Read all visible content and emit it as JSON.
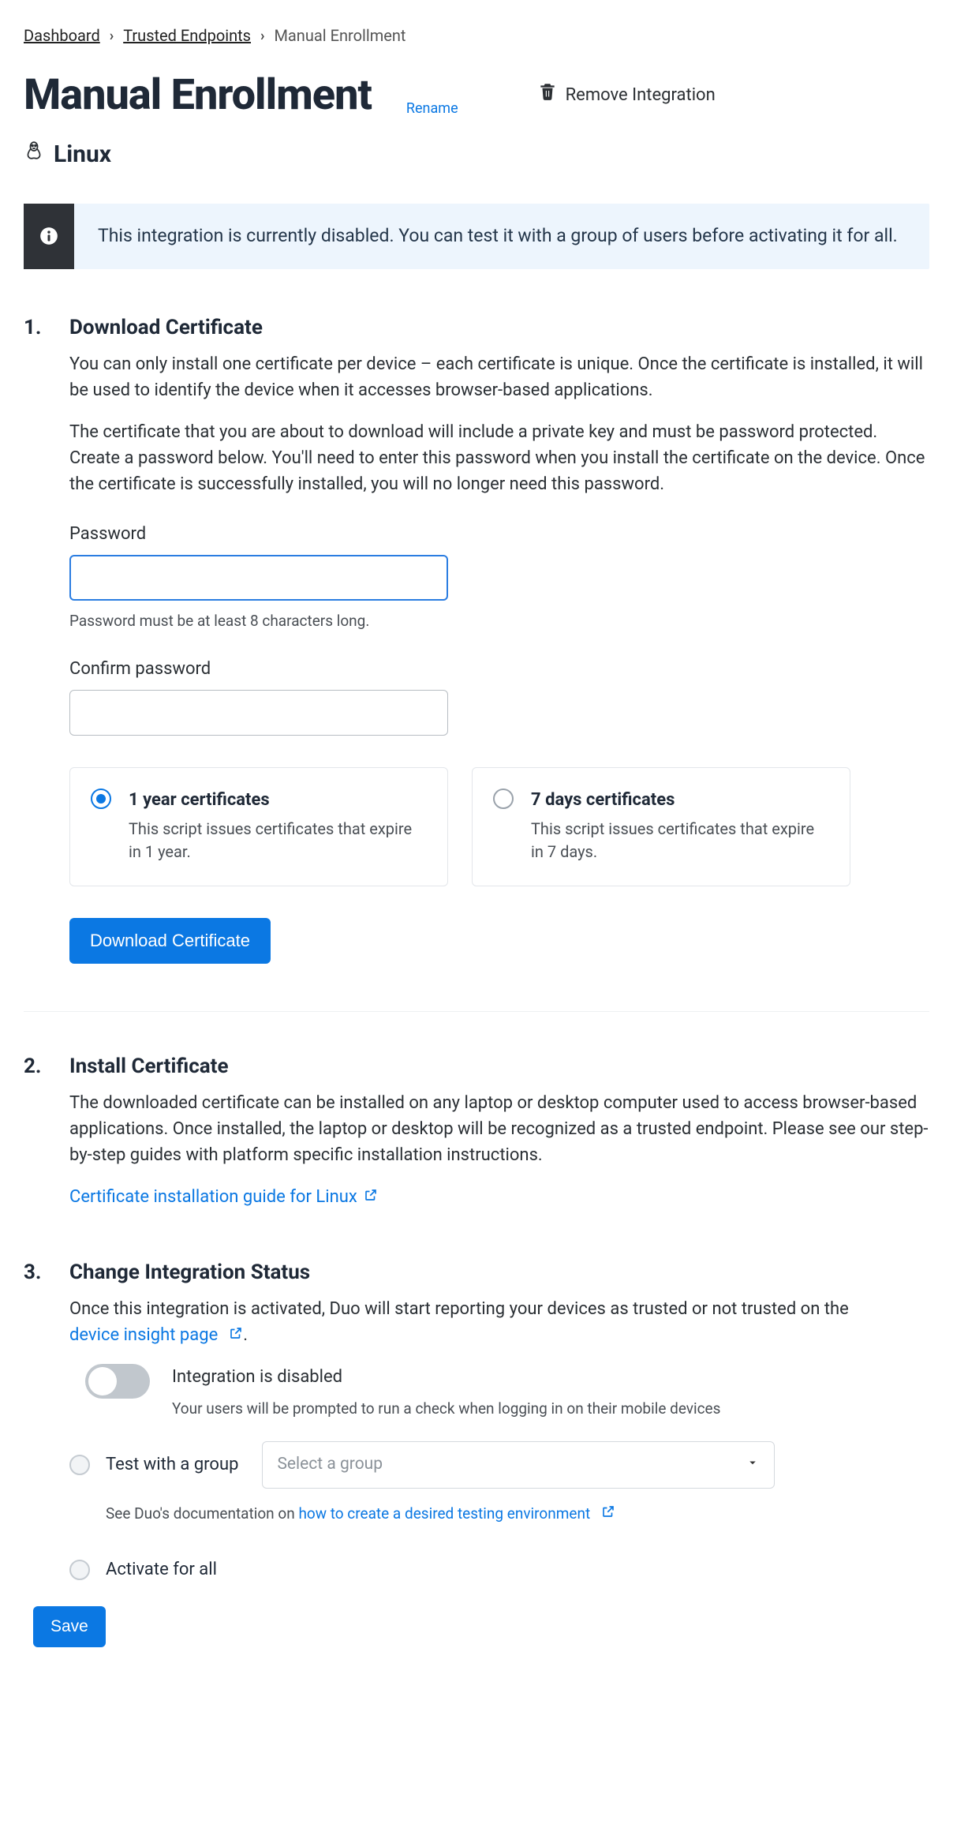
{
  "breadcrumb": {
    "items": [
      "Dashboard",
      "Trusted Endpoints"
    ],
    "current": "Manual Enrollment"
  },
  "header": {
    "title": "Manual Enrollment",
    "rename": "Rename",
    "remove": "Remove Integration"
  },
  "os": {
    "name": "Linux"
  },
  "banner": {
    "msg": "This integration is currently disabled. You can test it with a group of users before activating it for all."
  },
  "steps": {
    "s1": {
      "num": "1.",
      "title": "Download Certificate",
      "p1": "You can only install one certificate per device – each certificate is unique. Once the certificate is installed, it will be used to identify the device when it accesses browser-based applications.",
      "p2": "The certificate that you are about to download will include a private key and must be password protected. Create a password below. You'll need to enter this password when you install the certificate on the device. Once the certificate is successfully installed, you will no longer need this password.",
      "password_label": "Password",
      "password_hint": "Password must be at least 8 characters long.",
      "confirm_label": "Confirm password",
      "cert_options": {
        "opt1": {
          "title": "1 year certificates",
          "desc": "This script issues certificates that expire in 1 year."
        },
        "opt2": {
          "title": "7 days certificates",
          "desc": "This script issues certificates that expire in 7 days."
        }
      },
      "download_btn": "Download Certificate"
    },
    "s2": {
      "num": "2.",
      "title": "Install Certificate",
      "p1": "The downloaded certificate can be installed on any laptop or desktop computer used to access browser-based applications. Once installed, the laptop or desktop will be recognized as a trusted endpoint. Please see our step-by-step guides with platform specific installation instructions.",
      "guide_link": "Certificate installation guide for Linux"
    },
    "s3": {
      "num": "3.",
      "title": "Change Integration Status",
      "p1_pre": "Once this integration is activated, Duo will start reporting your devices as trusted or not trusted on the ",
      "p1_link": "device insight page",
      "p1_post": ".",
      "status_title": "Integration is disabled",
      "status_sub": "Your users will be prompted to run a check when logging in on their mobile devices",
      "test_label": "Test with a group",
      "select_placeholder": "Select a group",
      "doc_pre": "See Duo's documentation on ",
      "doc_link": "how to create a desired testing environment",
      "activate_label": "Activate for all",
      "save_btn": "Save"
    }
  }
}
